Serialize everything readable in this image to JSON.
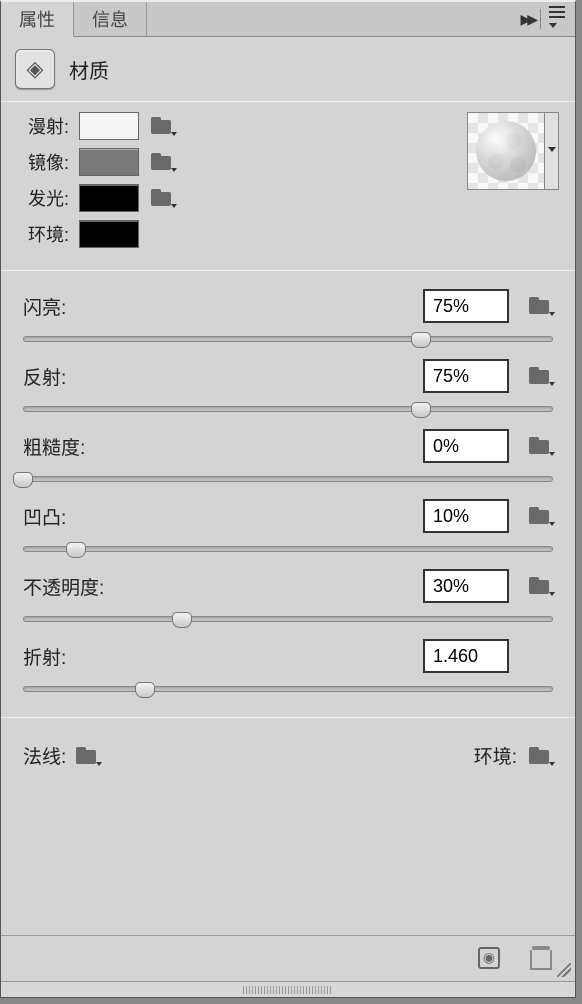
{
  "tabs": {
    "active": "属性",
    "inactive": "信息"
  },
  "header": {
    "title": "材质"
  },
  "colors": {
    "diffuse": {
      "label": "漫射:",
      "value": "#f5f5f5"
    },
    "specular": {
      "label": "镜像:",
      "value": "#7a7a7a"
    },
    "emissive": {
      "label": "发光:",
      "value": "#000000"
    },
    "ambient": {
      "label": "环境:",
      "value": "#000000"
    }
  },
  "sliders": {
    "shine": {
      "label": "闪亮:",
      "value": "75%",
      "pos": 75
    },
    "reflect": {
      "label": "反射:",
      "value": "75%",
      "pos": 75
    },
    "roughness": {
      "label": "粗糙度:",
      "value": "0%",
      "pos": 0
    },
    "bump": {
      "label": "凹凸:",
      "value": "10%",
      "pos": 10
    },
    "opacity": {
      "label": "不透明度:",
      "value": "30%",
      "pos": 30
    },
    "refract": {
      "label": "折射:",
      "value": "1.460",
      "pos": 23
    }
  },
  "bottom": {
    "normal": "法线:",
    "env": "环境:"
  }
}
